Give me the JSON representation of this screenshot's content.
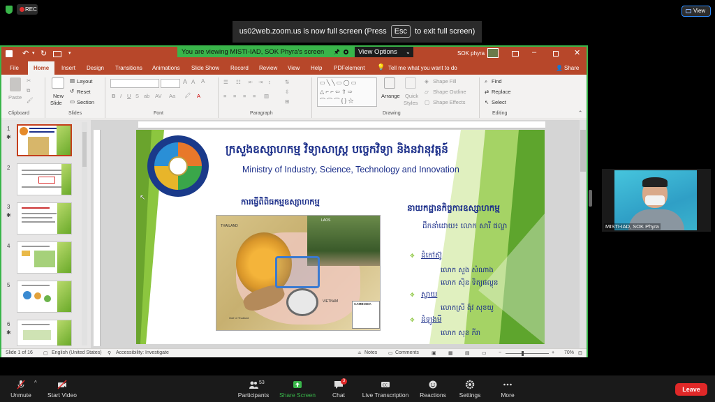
{
  "zoom": {
    "rec_label": "REC",
    "view_label": "View",
    "fullscreen_prefix": "us02web.zoom.us is now full screen (Press",
    "fullscreen_key": "Esc",
    "fullscreen_suffix": "to exit full screen)",
    "viewing_banner": "You are viewing MISTI-IAD, SOK Phyra's screen",
    "view_options": "View Options",
    "participant_name": "MISTI-IAD, SOK Phyra",
    "toolbar": {
      "unmute": "Unmute",
      "start_video": "Start Video",
      "participants": "Participants",
      "participants_count": "53",
      "share_screen": "Share Screen",
      "chat": "Chat",
      "chat_badge": "3",
      "live_transcription": "Live Transcription",
      "reactions": "Reactions",
      "settings": "Settings",
      "more": "More",
      "leave": "Leave"
    }
  },
  "ppt": {
    "user": "SOK phyra",
    "menu": [
      "File",
      "Home",
      "Insert",
      "Design",
      "Transitions",
      "Animations",
      "Slide Show",
      "Record",
      "Review",
      "View",
      "Help",
      "PDFelement"
    ],
    "tell_me": "Tell me what you want to do",
    "share": "Share",
    "ribbon": {
      "paste": "Paste",
      "clipboard": "Clipboard",
      "new_slide_line1": "New",
      "new_slide_line2": "Slide",
      "layout": "Layout",
      "reset": "Reset",
      "section": "Section",
      "slides": "Slides",
      "font": "Font",
      "paragraph": "Paragraph",
      "arrange": "Arrange",
      "quick_styles_line1": "Quick",
      "quick_styles_line2": "Styles",
      "shape_fill": "Shape Fill",
      "shape_outline": "Shape Outline",
      "shape_effects": "Shape Effects",
      "drawing": "Drawing",
      "find": "Find",
      "replace": "Replace",
      "select": "Select",
      "editing": "Editing"
    },
    "thumbnails": [
      "1",
      "2",
      "3",
      "4",
      "5",
      "6"
    ],
    "status": {
      "slide_of": "Slide 1 of 16",
      "language": "English (United States)",
      "accessibility": "Accessibility: Investigate",
      "notes": "Notes",
      "comments": "Comments",
      "zoom": "70%"
    }
  },
  "slide": {
    "title_khmer": "ក្រសួងឧស្សាហកម្ម វិទ្យាសាស្ត្រ បច្ចេកវិទ្យា និងនវានុវត្តន៍",
    "title_english": "Ministry of Industry, Science, Technology and Innovation",
    "left_heading": "ការធ្វើពិពិធកម្មឧស្សាហកម្ម",
    "right_heading": "នាយកដ្ឋានកិច្ចការឧស្សាហកម្ម",
    "led_by": "ដឹកនាំដោយ៖ លោក សារី ផល្លា",
    "groups": [
      {
        "heading": "ដំកៅស៊ូ",
        "names": [
          "លោក សួង សំណាង",
          "លោក ស៊ិន ទិត្យផល្លុន"
        ]
      },
      {
        "heading": "ស្វាយ",
        "names": [
          "លោកស្រី ង៉ុវ សុខយូ"
        ]
      },
      {
        "heading": "ដំឡូងមី",
        "names": [
          "លោក សុខ ភីរា"
        ]
      }
    ],
    "map_labels": {
      "thailand": "THAILAND",
      "laos": "LAOS",
      "vietnam": "VIETNAM",
      "cambodia": "CAMBODIA",
      "gulf": "Gulf of Thailand"
    }
  }
}
